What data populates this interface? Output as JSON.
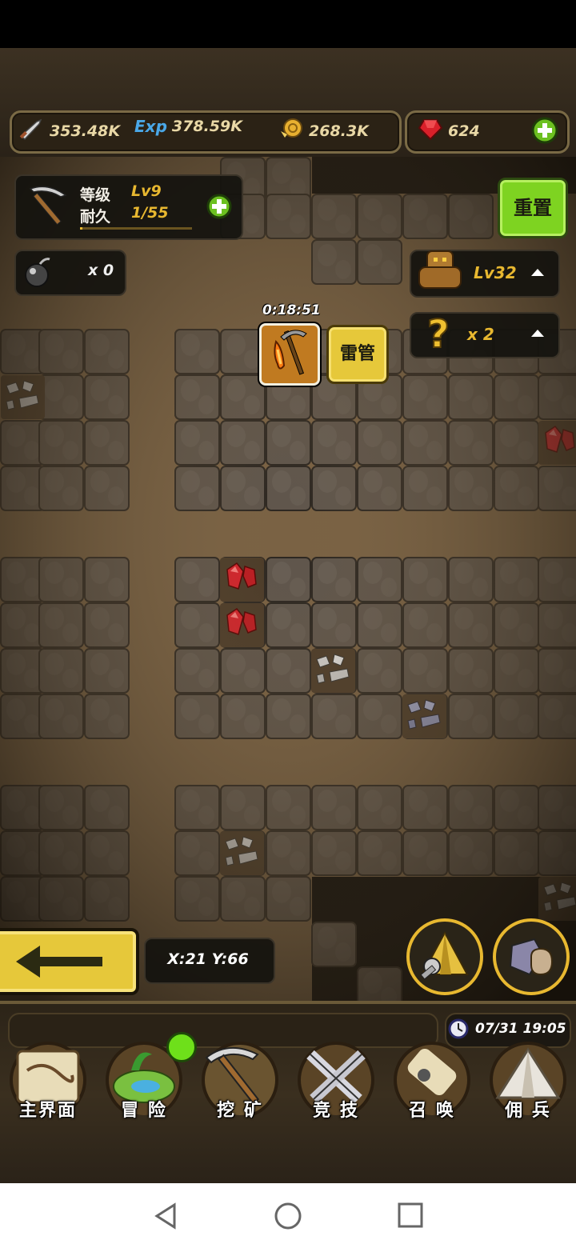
{
  "resources": {
    "attack": "353.48K",
    "exp_icon_text": "Exp",
    "exp": "378.59K",
    "gold": "268.3K",
    "gems": "624"
  },
  "pickaxe_panel": {
    "level_label": "等级",
    "level_value": "Lv9",
    "durability_label": "耐久",
    "durability_value": "1/55",
    "durability_fraction": 0.02
  },
  "bomb": {
    "count": "x 0"
  },
  "reset_button": "重置",
  "golem": {
    "level": "Lv32"
  },
  "mystery": {
    "count": "x 2"
  },
  "active_tool": {
    "timer": "0:18:51",
    "detonator_label": "雷管"
  },
  "coordinates": "X:21 Y:66",
  "clock": "07/31 19:05",
  "nav": [
    {
      "label": "主界面",
      "icon": "map-scroll-icon"
    },
    {
      "label": "冒 险",
      "icon": "island-icon"
    },
    {
      "label": "挖 矿",
      "icon": "pickaxe-icon"
    },
    {
      "label": "竞 技",
      "icon": "crossed-swords-icon"
    },
    {
      "label": "召 唤",
      "icon": "summon-scroll-icon"
    },
    {
      "label": "佣 兵",
      "icon": "tent-icon"
    }
  ],
  "colors": {
    "accent_gold": "#e8b830",
    "reset_green": "#7ed321",
    "gem_red": "#d9202a"
  }
}
